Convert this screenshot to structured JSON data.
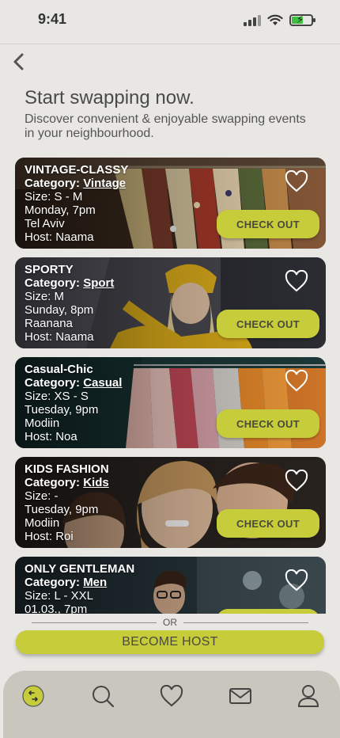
{
  "status": {
    "time": "9:41"
  },
  "page": {
    "title": "Start swapping now.",
    "subtitle": "Discover convenient & enjoyable swapping events in your neighbourhood."
  },
  "labels": {
    "category": "Category:",
    "size": "Size:",
    "host": "Host:",
    "checkout": "CHECK OUT",
    "or": "OR",
    "become_host": "BECOME HOST"
  },
  "events": [
    {
      "name": "VINTAGE-CLASSY",
      "category": "Vintage",
      "size": "S - M",
      "when": "Monday, 7pm",
      "city": "Tel Aviv",
      "host": "Naama"
    },
    {
      "name": "SPORTY",
      "category": "Sport",
      "size": "M",
      "when": "Sunday, 8pm",
      "city": "Raanana",
      "host": "Naama"
    },
    {
      "name": "Casual-Chic",
      "category": "Casual",
      "size": "XS - S",
      "when": "Tuesday, 9pm",
      "city": "Modiin",
      "host": "Noa"
    },
    {
      "name": "KIDS FASHION",
      "category": "Kids",
      "size": "-",
      "when": "Tuesday, 9pm",
      "city": "Modiin",
      "host": "Roi"
    },
    {
      "name": "ONLY GENTLEMAN",
      "category": "Men",
      "size": "L - XXL",
      "when": "01.03., 7pm",
      "city": "",
      "host": ""
    }
  ],
  "colors": {
    "accent": "#c7cc3a",
    "background": "#e8e7e3",
    "tabbar": "#c9c6bd"
  },
  "icons": {
    "back": "chevron-left-icon",
    "favorite": "heart-outline-icon",
    "tabs": [
      "home-swap-icon",
      "search-icon",
      "heart-icon",
      "mail-icon",
      "profile-icon"
    ]
  }
}
